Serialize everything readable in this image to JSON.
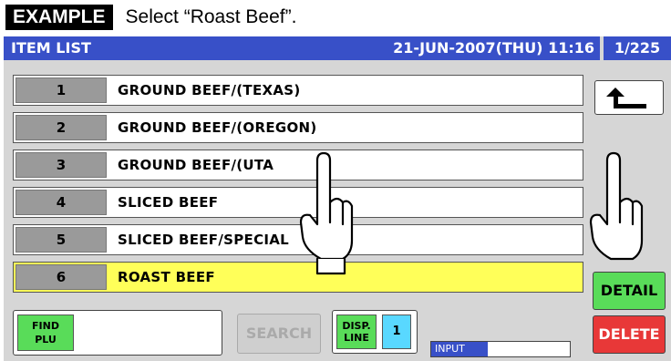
{
  "caption": {
    "tag": "EXAMPLE",
    "text": "Select “Roast Beef”."
  },
  "titlebar": {
    "title": "ITEM LIST",
    "datetime": "21-JUN-2007(THU)  11:16"
  },
  "page_indicator": "1/225",
  "items": [
    {
      "num": "1",
      "name": "GROUND BEEF/(TEXAS)"
    },
    {
      "num": "2",
      "name": "GROUND BEEF/(OREGON)"
    },
    {
      "num": "3",
      "name": "GROUND BEEF/(UTA"
    },
    {
      "num": "4",
      "name": "SLICED BEEF"
    },
    {
      "num": "5",
      "name": "SLICED BEEF/SPECIAL"
    },
    {
      "num": "6",
      "name": "ROAST BEEF"
    }
  ],
  "buttons": {
    "detail": "DETAIL",
    "delete": "DELETE",
    "search": "SEARCH",
    "find_plu_line1": "FIND",
    "find_plu_line2": "PLU",
    "disp_line_line1": "DISP.",
    "disp_line_line2": "LINE",
    "disp_line_value": "1",
    "input_label": "INPUT"
  },
  "icons": {
    "back": "return-arrow-icon",
    "pointer": "pointing-hand-icon"
  },
  "colors": {
    "title_blue": "#3850c8",
    "selected_row": "#ffff59",
    "green_button": "#59dc59",
    "red_button": "#e83838",
    "cyan_value": "#59d8ff"
  }
}
